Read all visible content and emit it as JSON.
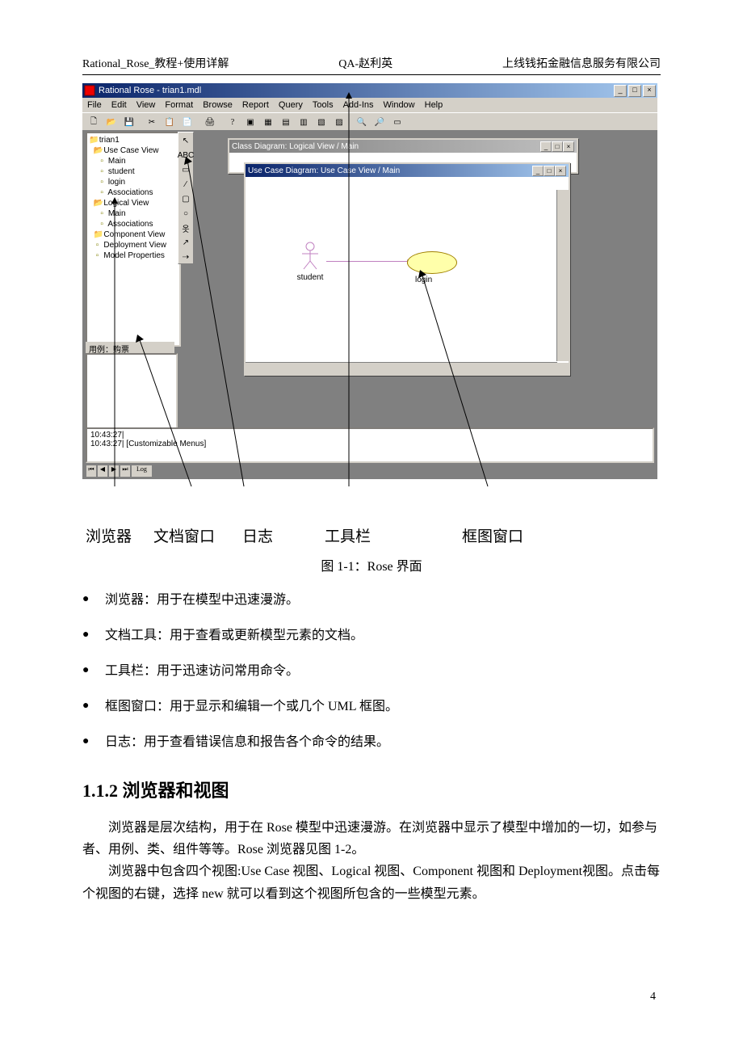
{
  "header": {
    "left": "Rational_Rose_教程+使用详解",
    "center": "QA-赵利英",
    "right": "上线钱拓金融信息服务有限公司"
  },
  "app": {
    "title": "Rational Rose - trian1.mdl",
    "menus": [
      "File",
      "Edit",
      "View",
      "Format",
      "Browse",
      "Report",
      "Query",
      "Tools",
      "Add-Ins",
      "Window",
      "Help"
    ],
    "tree": [
      {
        "indent": 0,
        "icon": "📁",
        "label": "trian1"
      },
      {
        "indent": 1,
        "icon": "📂",
        "label": "Use Case View"
      },
      {
        "indent": 2,
        "icon": "",
        "label": "Main"
      },
      {
        "indent": 2,
        "icon": "",
        "label": "student"
      },
      {
        "indent": 2,
        "icon": "",
        "label": "login"
      },
      {
        "indent": 2,
        "icon": "",
        "label": "Associations"
      },
      {
        "indent": 1,
        "icon": "📂",
        "label": "Logical View"
      },
      {
        "indent": 2,
        "icon": "",
        "label": "Main"
      },
      {
        "indent": 2,
        "icon": "",
        "label": "Associations"
      },
      {
        "indent": 1,
        "icon": "📁",
        "label": "Component View"
      },
      {
        "indent": 1,
        "icon": "",
        "label": "Deployment View"
      },
      {
        "indent": 1,
        "icon": "",
        "label": "Model Properties"
      }
    ],
    "doc_caption": "用例：购票",
    "class_diagram_title": "Class Diagram: Logical View / Main",
    "usecase_diagram_title": "Use Case Diagram: Use Case View / Main",
    "actor_label": "student",
    "usecase_label": "login",
    "palette_text": "ABC",
    "log": {
      "line1": "10:43:27|",
      "line2": "10:43:27|  [Customizable Menus]",
      "tab": "Log"
    }
  },
  "annotations": {
    "browser": "浏览器",
    "docwin": "文档窗口",
    "log": "日志",
    "toolbar": "工具栏",
    "diagram": "框图窗口"
  },
  "caption": "图 1-1：Rose 界面",
  "bullets": [
    "浏览器：用于在模型中迅速漫游。",
    "文档工具：用于查看或更新模型元素的文档。",
    "工具栏：用于迅速访问常用命令。",
    "框图窗口：用于显示和编辑一个或几个 UML 框图。",
    "日志：用于查看错误信息和报告各个命令的结果。"
  ],
  "section_heading": "1.1.2 浏览器和视图",
  "para1": "浏览器是层次结构，用于在 Rose 模型中迅速漫游。在浏览器中显示了模型中增加的一切，如参与者、用例、类、组件等等。Rose 浏览器见图 1-2。",
  "para2": "浏览器中包含四个视图:Use Case 视图、Logical 视图、Component 视图和 Deployment视图。点击每个视图的右键，选择 new 就可以看到这个视图所包含的一些模型元素。",
  "page_number": "4"
}
